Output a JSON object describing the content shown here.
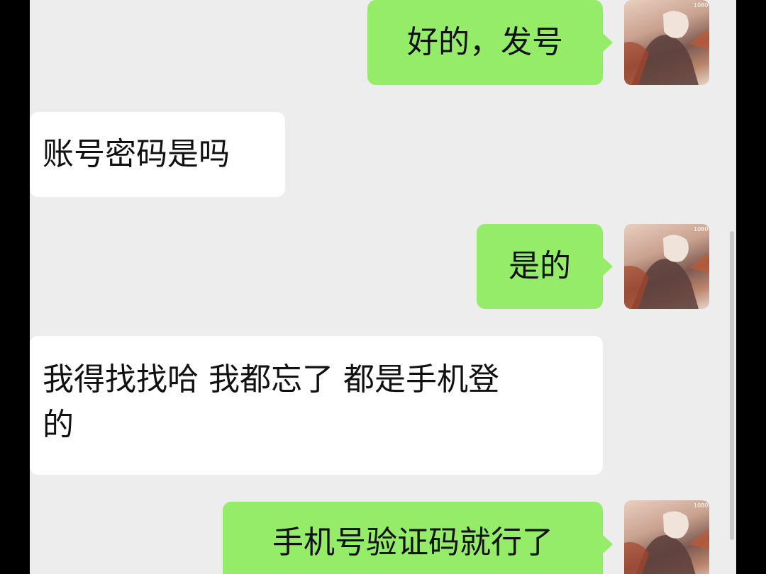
{
  "messages": [
    {
      "side": "sent",
      "text": "好的，发号"
    },
    {
      "side": "received",
      "text": "账号密码是吗"
    },
    {
      "side": "sent",
      "text": "是的"
    },
    {
      "side": "received",
      "line1": "我得找找哈 我都忘了 都是手机登",
      "line2": "的"
    },
    {
      "side": "sent",
      "text": "手机号验证码就行了"
    }
  ],
  "avatar_badge": "1080"
}
